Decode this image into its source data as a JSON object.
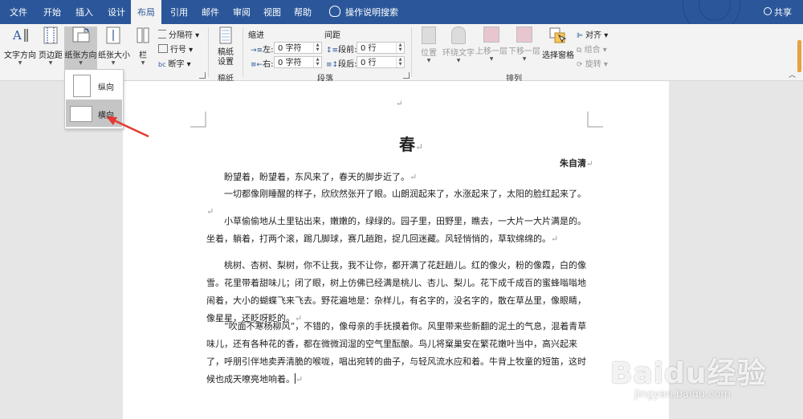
{
  "menu": {
    "tabs": [
      "文件",
      "开始",
      "插入",
      "设计",
      "布局",
      "引用",
      "邮件",
      "审阅",
      "视图",
      "帮助"
    ],
    "active_tab": "布局",
    "tell_me": "操作说明搜索",
    "share": "共享"
  },
  "ribbon": {
    "text_direction": "文字方向",
    "margins": "页边距",
    "orientation": "纸张方向",
    "size": "纸张大小",
    "columns": "栏",
    "breaks": "分隔符",
    "line_numbers": "行号",
    "hyphenation": "断字",
    "draft_paper": "稿纸\n设置",
    "draft_paper_group": "稿纸",
    "indent_heading": "缩进",
    "spacing_heading": "间距",
    "indent_left_label": "左:",
    "indent_left_value": "0 字符",
    "indent_right_label": "右:",
    "indent_right_value": "0 字符",
    "spacing_before_label": "段前:",
    "spacing_before_value": "0 行",
    "spacing_after_label": "段后:",
    "spacing_after_value": "0 行",
    "paragraph_group": "段落",
    "position": "位置",
    "wrap_text": "环绕文字",
    "bring_forward": "上移一层",
    "send_backward": "下移一层",
    "selection_pane": "选择窗格",
    "align": "对齐",
    "group": "组合",
    "rotate": "旋转",
    "arrange_group": "排列"
  },
  "orientation_menu": {
    "portrait": "纵向",
    "landscape": "横向",
    "selected": "横向"
  },
  "document": {
    "top_mark": "↵",
    "title": "春",
    "author": "朱自清",
    "paragraph_mark": "↵",
    "paragraphs": [
      "盼望着，盼望着，东风来了，春天的脚步近了。",
      "一切都像刚睡醒的样子，欣欣然张开了眼。山朗润起来了，水涨起来了，太阳的脸红起来了。",
      "小草偷偷地从土里钻出来，嫩嫩的，绿绿的。园子里，田野里，瞧去，一大片一大片满是的。坐着，躺着，打两个滚，踢几脚球，赛几趟跑，捉几回迷藏。风轻悄悄的，草软绵绵的。",
      "桃树、杏树、梨树，你不让我，我不让你，都开满了花赶趟儿。红的像火，粉的像霞，白的像雪。花里带着甜味儿；闭了眼，树上仿佛已经满是桃儿、杏儿、梨儿。花下成千成百的蜜蜂嗡嗡地闹着，大小的蝴蝶飞来飞去。野花遍地是：杂样儿，有名字的，没名字的，散在草丛里，像眼睛，像星星，还眨呀眨的。",
      "“吹面不寒杨柳风”，不错的，像母亲的手抚摸着你。风里带来些新翻的泥土的气息，混着青草味儿，还有各种花的香，都在微微润湿的空气里酝酿。鸟儿将窠巢安在繁花嫩叶当中，高兴起来了，呼朋引伴地卖弄清脆的喉咙，唱出宛转的曲子，与轻风流水应和着。牛背上牧童的短笛，这时候也成天嘹亮地响着。"
    ]
  },
  "watermark": {
    "brand": "Baidu经验",
    "url": "jingyan.baidu.com"
  },
  "colors": {
    "titlebar": "#2b579a",
    "ribbon_bg": "#f3f3f3",
    "canvas_bg": "#e6e6e6",
    "arrow": "#e53935"
  }
}
